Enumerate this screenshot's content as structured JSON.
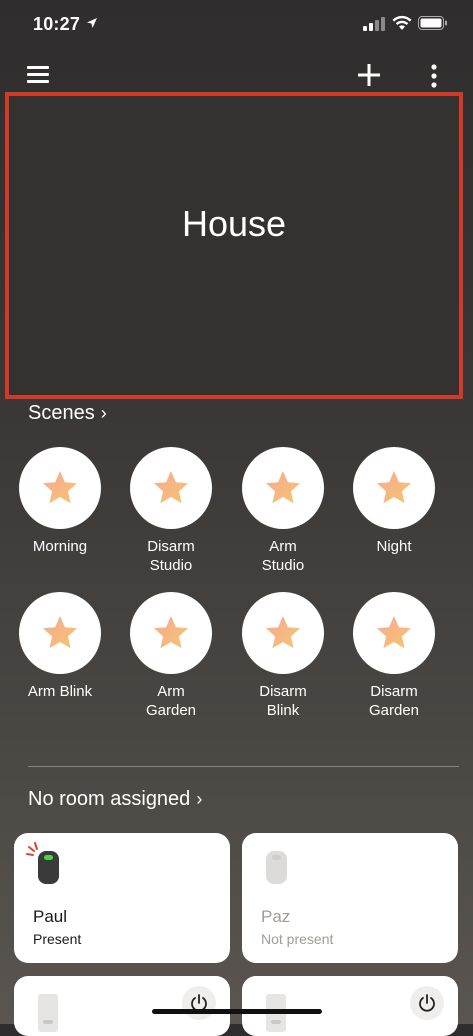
{
  "status_bar": {
    "time": "10:27"
  },
  "toolbar": {
    "menu_icon": "hamburger-menu-icon",
    "add_icon": "plus-icon",
    "more_icon": "vertical-dots-icon"
  },
  "house": {
    "title": "House",
    "highlight_color": "#d03a26"
  },
  "scenes": {
    "header": "Scenes",
    "items": [
      {
        "label": "Morning"
      },
      {
        "label": "Disarm\nStudio"
      },
      {
        "label": "Arm\nStudio"
      },
      {
        "label": "Night"
      },
      {
        "label": "Arm Blink"
      },
      {
        "label": "Arm\nGarden"
      },
      {
        "label": "Disarm\nBlink"
      },
      {
        "label": "Disarm\nGarden"
      }
    ]
  },
  "room": {
    "header": "No room assigned",
    "devices": [
      {
        "name": "Paul",
        "status": "Present"
      },
      {
        "name": "Paz",
        "status": "Not present"
      }
    ]
  }
}
